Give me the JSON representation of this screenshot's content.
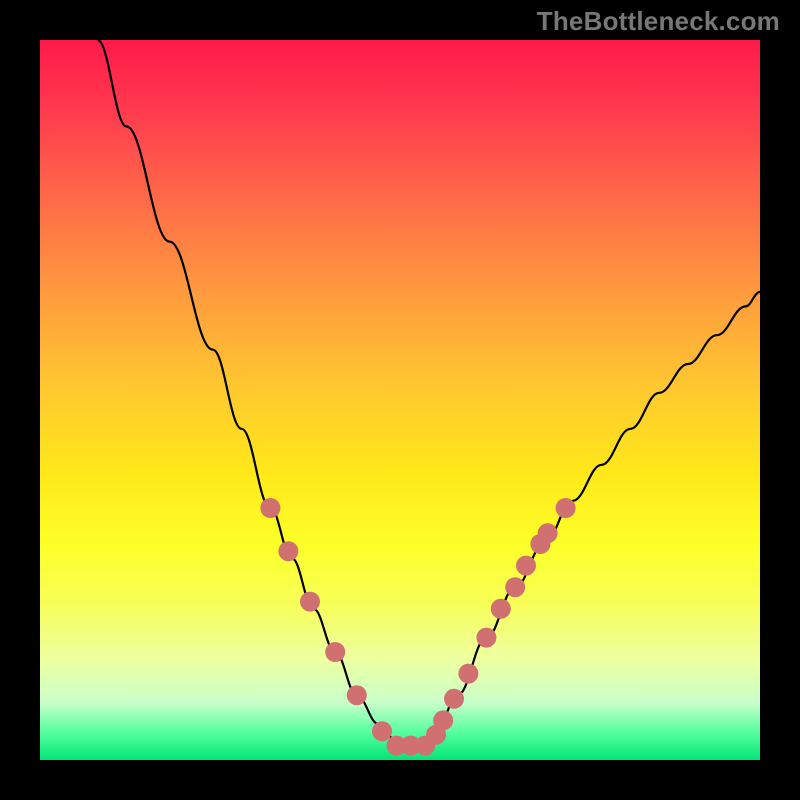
{
  "watermark": "TheBottleneck.com",
  "chart_data": {
    "type": "line",
    "title": "",
    "xlabel": "",
    "ylabel": "",
    "xlim": [
      0,
      100
    ],
    "ylim": [
      0,
      100
    ],
    "series": [
      {
        "name": "bottleneck-curve",
        "x": [
          8,
          12,
          18,
          24,
          28,
          32,
          35,
          38,
          41,
          44,
          47,
          50,
          53,
          55,
          58,
          62,
          66,
          70,
          74,
          78,
          82,
          86,
          90,
          94,
          98,
          100
        ],
        "y": [
          100,
          88,
          72,
          57,
          46,
          35,
          28,
          21,
          15,
          9,
          5,
          2,
          2,
          4,
          9,
          17,
          24,
          30,
          36,
          41,
          46,
          51,
          55,
          59,
          63,
          65
        ]
      }
    ],
    "markers": {
      "name": "highlight-points",
      "color": "#d07070",
      "x": [
        32,
        34.5,
        37.5,
        41,
        44,
        47.5,
        49.5,
        51.5,
        53.5,
        55,
        56,
        57.5,
        59.5,
        62,
        64,
        66,
        67.5,
        69.5,
        70.5,
        73
      ],
      "y": [
        35,
        29,
        22,
        15,
        9,
        4,
        2,
        2,
        2,
        3.5,
        5.5,
        8.5,
        12,
        17,
        21,
        24,
        27,
        30,
        31.5,
        35
      ]
    }
  }
}
